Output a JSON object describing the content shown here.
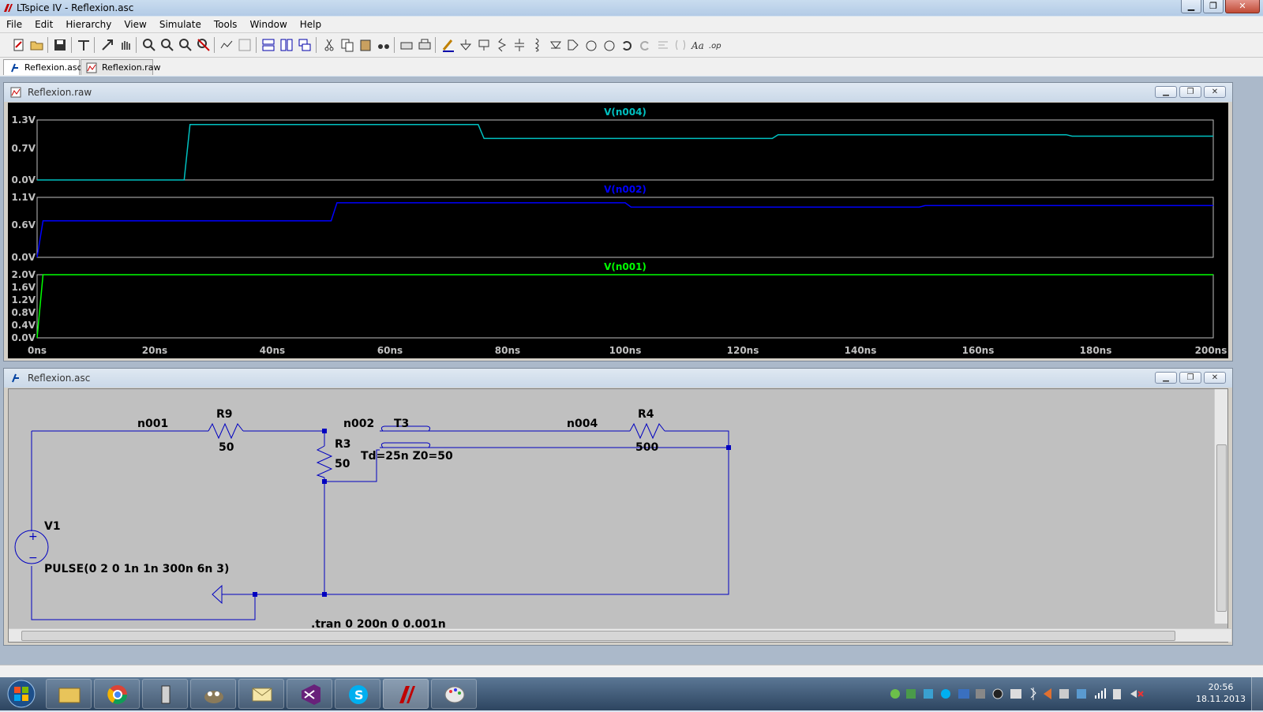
{
  "window": {
    "title": "LTspice IV - Reflexion.asc"
  },
  "menu": [
    "File",
    "Edit",
    "Hierarchy",
    "View",
    "Simulate",
    "Tools",
    "Window",
    "Help"
  ],
  "tabs": [
    {
      "label": "Reflexion.asc",
      "active": true
    },
    {
      "label": "Reflexion.raw",
      "active": false
    }
  ],
  "waveform_window": {
    "title": "Reflexion.raw",
    "panes": [
      {
        "trace": "V(n004)",
        "color": "#00c0c0",
        "yticks": [
          "1.3V",
          "0.7V",
          "0.0V"
        ]
      },
      {
        "trace": "V(n002)",
        "color": "#0000ff",
        "yticks": [
          "1.1V",
          "0.6V",
          "0.0V"
        ]
      },
      {
        "trace": "V(n001)",
        "color": "#00ff00",
        "yticks": [
          "2.0V",
          "1.6V",
          "1.2V",
          "0.8V",
          "0.4V",
          "0.0V"
        ]
      }
    ],
    "xticks": [
      "0ns",
      "20ns",
      "40ns",
      "60ns",
      "80ns",
      "100ns",
      "120ns",
      "140ns",
      "160ns",
      "180ns",
      "200ns"
    ]
  },
  "chart_data": [
    {
      "type": "line",
      "title": "V(n004)",
      "xlim": [
        0,
        200
      ],
      "ylim": [
        0,
        1.3
      ],
      "series": [
        {
          "name": "V(n004)",
          "x": [
            0,
            25,
            26,
            75,
            76,
            125,
            126,
            175,
            176,
            200
          ],
          "values": [
            0,
            0,
            1.2,
            1.2,
            0.9,
            0.9,
            0.98,
            0.98,
            0.95,
            0.95
          ]
        }
      ]
    },
    {
      "type": "line",
      "title": "V(n002)",
      "xlim": [
        0,
        200
      ],
      "ylim": [
        0,
        1.1
      ],
      "series": [
        {
          "name": "V(n002)",
          "x": [
            0,
            1,
            50,
            51,
            100,
            101,
            150,
            151,
            200
          ],
          "values": [
            0,
            0.67,
            0.67,
            1.0,
            1.0,
            0.92,
            0.92,
            0.95,
            0.95
          ]
        }
      ]
    },
    {
      "type": "line",
      "title": "V(n001)",
      "xlim": [
        0,
        200
      ],
      "ylim": [
        0,
        2.0
      ],
      "series": [
        {
          "name": "V(n001)",
          "x": [
            0,
            1,
            200
          ],
          "values": [
            0,
            2.0,
            2.0
          ]
        }
      ]
    }
  ],
  "schematic_window": {
    "title": "Reflexion.asc",
    "nets": {
      "n001": "n001",
      "n002": "n002",
      "n004": "n004"
    },
    "components": {
      "R9": {
        "name": "R9",
        "value": "50"
      },
      "R3": {
        "name": "R3",
        "value": "50"
      },
      "R4": {
        "name": "R4",
        "value": "500"
      },
      "T3": {
        "name": "T3",
        "value": "Td=25n Z0=50"
      },
      "V1": {
        "name": "V1",
        "value": "PULSE(0 2 0 1n 1n 300n 6n 3)"
      }
    },
    "directive": ".tran 0 200n 0 0.001n"
  },
  "taskbar": {
    "apps": [
      "explorer",
      "chrome",
      "usb-drive",
      "gimp",
      "mail",
      "visual-studio",
      "skype",
      "ltspice",
      "paint"
    ],
    "clock_time": "20:56",
    "clock_date": "18.11.2013"
  }
}
